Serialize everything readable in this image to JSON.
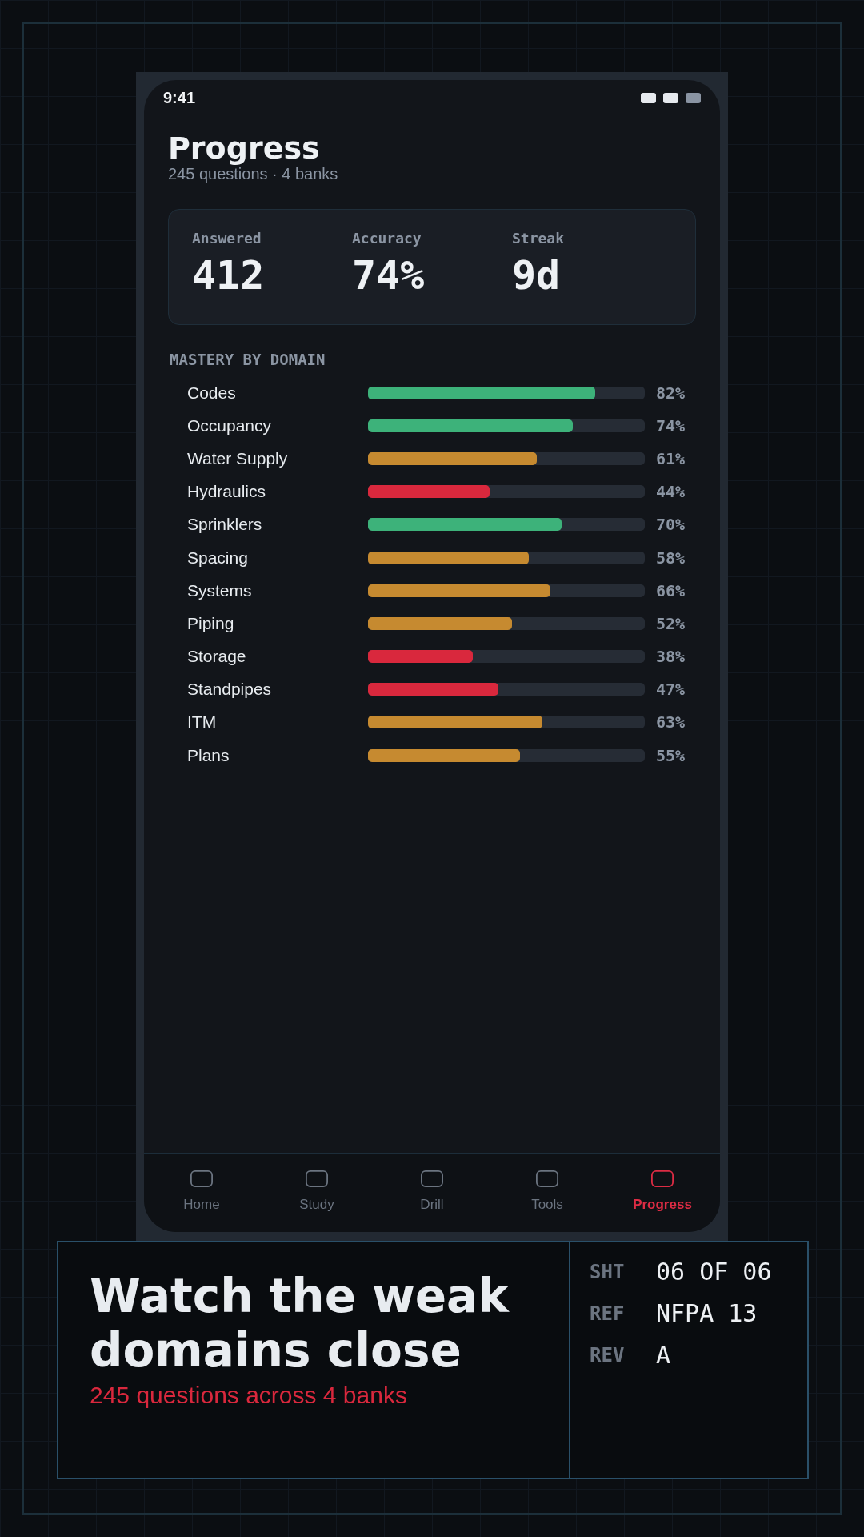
{
  "status_bar": {
    "time": "9:41"
  },
  "header": {
    "title": "Progress",
    "subtitle": "245 questions · 4 banks"
  },
  "stats": [
    {
      "label": "Answered",
      "value": "412"
    },
    {
      "label": "Accuracy",
      "value": "74%"
    },
    {
      "label": "Streak",
      "value": "9d"
    }
  ],
  "mastery": {
    "heading": "MASTERY BY DOMAIN",
    "domains": [
      {
        "name": "Codes",
        "level": 0.82,
        "color": "#3db27a",
        "reading": "82%"
      },
      {
        "name": "Occupancy",
        "level": 0.74,
        "color": "#3db27a",
        "reading": "74%"
      },
      {
        "name": "Water Supply",
        "level": 0.61,
        "color": "#c68a30",
        "reading": "61%"
      },
      {
        "name": "Hydraulics",
        "level": 0.44,
        "color": "#d9283d",
        "reading": "44%"
      },
      {
        "name": "Sprinklers",
        "level": 0.7,
        "color": "#3db27a",
        "reading": "70%"
      },
      {
        "name": "Spacing",
        "level": 0.58,
        "color": "#c68a30",
        "reading": "58%"
      },
      {
        "name": "Systems",
        "level": 0.66,
        "color": "#c68a30",
        "reading": "66%"
      },
      {
        "name": "Piping",
        "level": 0.52,
        "color": "#c68a30",
        "reading": "52%"
      },
      {
        "name": "Storage",
        "level": 0.38,
        "color": "#d9283d",
        "reading": "38%"
      },
      {
        "name": "Standpipes",
        "level": 0.47,
        "color": "#d9283d",
        "reading": "47%"
      },
      {
        "name": "ITM",
        "level": 0.63,
        "color": "#c68a30",
        "reading": "63%"
      },
      {
        "name": "Plans",
        "level": 0.55,
        "color": "#c68a30",
        "reading": "55%"
      }
    ]
  },
  "tab_bar": [
    {
      "label": "Home",
      "selected": false
    },
    {
      "label": "Study",
      "selected": false
    },
    {
      "label": "Drill",
      "selected": false
    },
    {
      "label": "Tools",
      "selected": false
    },
    {
      "label": "Progress",
      "selected": true
    }
  ],
  "caption": {
    "title": "Watch the weak domains close",
    "subtitle": "245 questions across 4 banks",
    "meta": [
      {
        "label": "SHT",
        "value": "06 OF 06"
      },
      {
        "label": "REF",
        "value": "NFPA 13"
      },
      {
        "label": "REV",
        "value": "A"
      }
    ]
  }
}
